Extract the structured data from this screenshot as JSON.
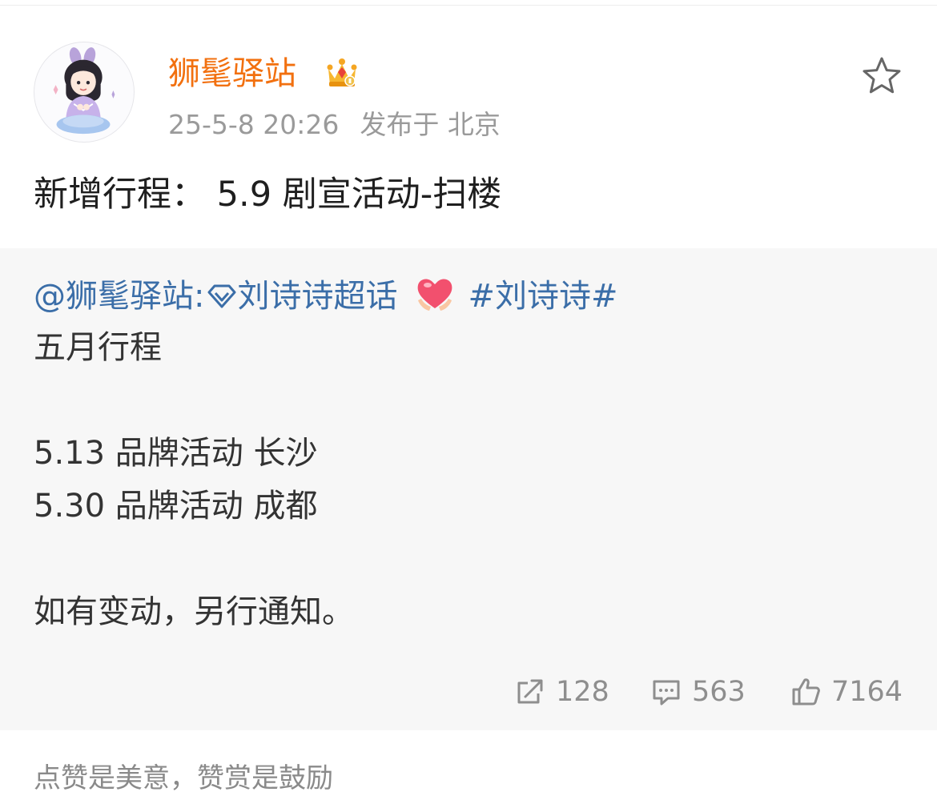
{
  "post": {
    "username": "狮髦驿站",
    "timestamp": "25-5-8 20:26",
    "location_text": "发布于 北京",
    "content": "新增行程：  5.9 剧宣活动-扫楼"
  },
  "repost": {
    "mention": "@狮髦驿站",
    "colon": ":",
    "supertopic": "刘诗诗超话",
    "hashtag": "#刘诗诗#",
    "lines": {
      "l1": "五月行程",
      "l2": "5.13 品牌活动 长沙",
      "l3": "5.30 品牌活动 成都",
      "l4": "如有变动，另行通知。"
    },
    "stats": {
      "reposts": "128",
      "comments": "563",
      "likes": "7164"
    }
  },
  "footer": {
    "note": "点赞是美意，赞赏是鼓励"
  },
  "icons": {
    "crown": "crown-badge-icon",
    "favorite": "star-outline-icon",
    "supertopic": "diamond-icon",
    "emoji": "heart-hands-icon",
    "repost": "share-arrow-icon",
    "comment": "comment-icon",
    "like": "thumbs-up-icon"
  },
  "colors": {
    "username": "#f2700f",
    "link": "#3b6ea8",
    "repost_bg": "#f7f7f7",
    "meta": "#9a9a9a"
  }
}
